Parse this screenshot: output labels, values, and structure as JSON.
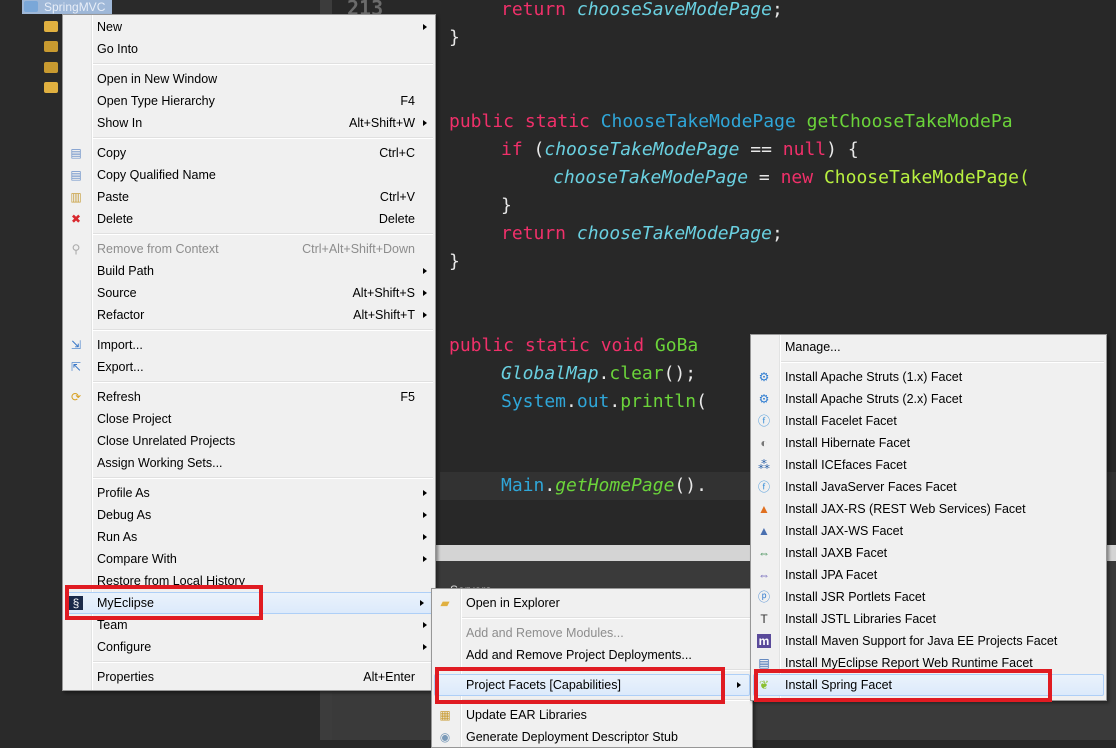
{
  "tree": {
    "project": "SpringMVC"
  },
  "editor": {
    "line_number": "213",
    "lines": [
      [
        [
          "k",
          "return "
        ],
        [
          "v",
          "chooseSaveModePage"
        ],
        [
          "p",
          ";"
        ]
      ],
      [
        [
          "p",
          "}"
        ]
      ],
      [
        [
          "k",
          "public static "
        ],
        [
          "t",
          "ChooseTakeModePage "
        ],
        [
          "m",
          "getChooseTakeModePa"
        ]
      ],
      [
        [
          "k",
          "if "
        ],
        [
          "p",
          "("
        ],
        [
          "v",
          "chooseTakeModePage"
        ],
        [
          "p",
          " == "
        ],
        [
          "k",
          "null"
        ],
        [
          "p",
          ") {"
        ]
      ],
      [
        [
          "v",
          "chooseTakeModePage"
        ],
        [
          "p",
          " = "
        ],
        [
          "k",
          "new "
        ],
        [
          "c",
          "ChooseTakeModePage("
        ]
      ],
      [
        [
          "p",
          "}"
        ]
      ],
      [
        [
          "k",
          "return "
        ],
        [
          "v",
          "chooseTakeModePage"
        ],
        [
          "p",
          ";"
        ]
      ],
      [
        [
          "p",
          "}"
        ]
      ],
      [
        [
          "k",
          "public static void "
        ],
        [
          "m",
          "GoBa"
        ]
      ],
      [
        [
          "v",
          "GlobalMap"
        ],
        [
          "p",
          "."
        ],
        [
          "m",
          "clear"
        ],
        [
          "p",
          "();"
        ]
      ],
      [
        [
          "t",
          "System"
        ],
        [
          "p",
          "."
        ],
        [
          "t",
          "out"
        ],
        [
          "p",
          "."
        ],
        [
          "m",
          "println"
        ],
        [
          "p",
          "("
        ]
      ],
      [
        [
          "t",
          "Main"
        ],
        [
          "p",
          "."
        ],
        [
          "mi",
          "getHomePage"
        ],
        [
          "p",
          "()."
        ]
      ]
    ]
  },
  "bottom_panel": {
    "tab": "Servers"
  },
  "context_menu": {
    "items": [
      {
        "label": "New",
        "arrow": true
      },
      {
        "label": "Go Into"
      },
      {
        "sep": true
      },
      {
        "label": "Open in New Window"
      },
      {
        "label": "Open Type Hierarchy",
        "shortcut": "F4"
      },
      {
        "label": "Show In",
        "shortcut": "Alt+Shift+W",
        "arrow": true
      },
      {
        "sep": true
      },
      {
        "label": "Copy",
        "shortcut": "Ctrl+C",
        "icon": "copy-icon"
      },
      {
        "label": "Copy Qualified Name",
        "icon": "copy-qualified-icon"
      },
      {
        "label": "Paste",
        "shortcut": "Ctrl+V",
        "icon": "paste-icon"
      },
      {
        "label": "Delete",
        "shortcut": "Delete",
        "icon": "delete-icon"
      },
      {
        "sep": true
      },
      {
        "label": "Remove from Context",
        "shortcut": "Ctrl+Alt+Shift+Down",
        "disabled": true,
        "icon": "remove-context-icon"
      },
      {
        "label": "Build Path",
        "arrow": true
      },
      {
        "label": "Source",
        "shortcut": "Alt+Shift+S",
        "arrow": true
      },
      {
        "label": "Refactor",
        "shortcut": "Alt+Shift+T",
        "arrow": true
      },
      {
        "sep": true
      },
      {
        "label": "Import...",
        "icon": "import-icon"
      },
      {
        "label": "Export...",
        "icon": "export-icon"
      },
      {
        "sep": true
      },
      {
        "label": "Refresh",
        "shortcut": "F5",
        "icon": "refresh-icon"
      },
      {
        "label": "Close Project"
      },
      {
        "label": "Close Unrelated Projects"
      },
      {
        "label": "Assign Working Sets..."
      },
      {
        "sep": true
      },
      {
        "label": "Profile As",
        "arrow": true
      },
      {
        "label": "Debug As",
        "arrow": true
      },
      {
        "label": "Run As",
        "arrow": true
      },
      {
        "label": "Compare With",
        "arrow": true
      },
      {
        "label": "Restore from Local History"
      },
      {
        "label": "MyEclipse",
        "arrow": true,
        "highlighted": true,
        "icon": "myeclipse-icon"
      },
      {
        "label": "Team",
        "arrow": true
      },
      {
        "label": "Configure",
        "arrow": true
      },
      {
        "sep": true
      },
      {
        "label": "Properties",
        "shortcut": "Alt+Enter"
      }
    ]
  },
  "myeclipse_submenu": {
    "items": [
      {
        "label": "Open in Explorer",
        "icon": "folder-open-icon"
      },
      {
        "sep": true
      },
      {
        "label": "Add and Remove Modules...",
        "disabled": true
      },
      {
        "label": "Add and Remove Project Deployments..."
      },
      {
        "sep": true
      },
      {
        "label": "Project Facets [Capabilities]",
        "arrow": true,
        "highlighted": true
      },
      {
        "sep": true
      },
      {
        "label": "Update EAR Libraries",
        "icon": "library-icon"
      },
      {
        "label": "Generate Deployment Descriptor Stub",
        "icon": "descriptor-icon"
      }
    ]
  },
  "facets_submenu": {
    "items": [
      {
        "label": "Manage..."
      },
      {
        "sep": true
      },
      {
        "label": "Install Apache Struts (1.x) Facet",
        "icon": "struts-gear-icon"
      },
      {
        "label": "Install Apache Struts (2.x) Facet",
        "icon": "struts-gear-icon"
      },
      {
        "label": "Install Facelet Facet",
        "icon": "facelet-icon"
      },
      {
        "label": "Install Hibernate Facet",
        "icon": "hibernate-icon"
      },
      {
        "label": "Install ICEfaces Facet",
        "icon": "icefaces-icon"
      },
      {
        "label": "Install JavaServer Faces Facet",
        "icon": "jsf-icon"
      },
      {
        "label": "Install JAX-RS (REST Web Services) Facet",
        "icon": "jaxrs-icon"
      },
      {
        "label": "Install JAX-WS Facet",
        "icon": "jaxws-icon"
      },
      {
        "label": "Install JAXB Facet",
        "icon": "jaxb-icon"
      },
      {
        "label": "Install JPA Facet",
        "icon": "jpa-icon"
      },
      {
        "label": "Install JSR Portlets Facet",
        "icon": "portlet-icon"
      },
      {
        "label": "Install JSTL Libraries Facet",
        "icon": "jstl-icon"
      },
      {
        "label": "Install Maven Support for Java EE Projects Facet",
        "icon": "maven-icon"
      },
      {
        "label": "Install MyEclipse Report Web Runtime Facet",
        "icon": "report-icon"
      },
      {
        "label": "Install Spring Facet",
        "icon": "spring-leaf-icon",
        "highlighted": true
      }
    ]
  },
  "colors": {
    "highlight_box": "#e01b22",
    "menu_bg": "#f0f0f0",
    "editor_bg": "#282828"
  }
}
